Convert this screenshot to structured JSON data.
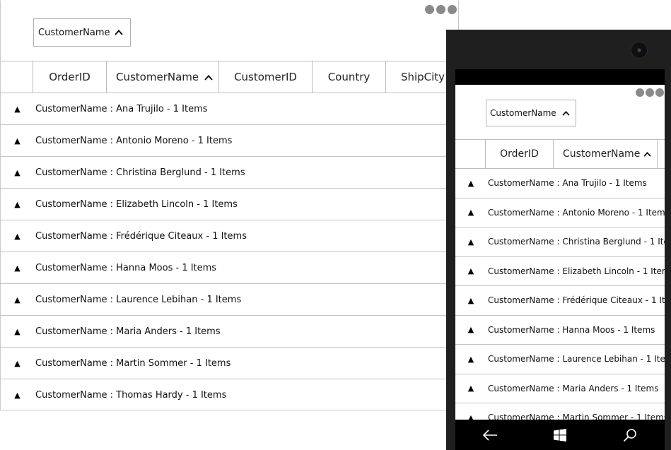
{
  "group_drop_area": {
    "chip_label": "CustomerName"
  },
  "columns": [
    "OrderID",
    "CustomerName",
    "CustomerID",
    "Country",
    "ShipCity"
  ],
  "groups": [
    {
      "caption": "CustomerName : Ana Trujilo - 1 Items"
    },
    {
      "caption": "CustomerName : Antonio Moreno - 1 Items"
    },
    {
      "caption": "CustomerName : Christina Berglund - 1 Items"
    },
    {
      "caption": "CustomerName : Elizabeth Lincoln - 1 Items"
    },
    {
      "caption": "CustomerName : Frédérique Citeaux - 1 Items"
    },
    {
      "caption": "CustomerName : Hanna Moos - 1 Items"
    },
    {
      "caption": "CustomerName : Laurence Lebihan - 1 Items"
    },
    {
      "caption": "CustomerName : Maria Anders - 1 Items"
    },
    {
      "caption": "CustomerName : Martin Sommer - 1 Items"
    },
    {
      "caption": "CustomerName : Thomas Hardy - 1 Items"
    }
  ],
  "expander_glyph": "▲",
  "icons": {
    "more": "more-dots-icon",
    "sort": "chevron-up-icon",
    "back": "back-arrow-icon",
    "home": "windows-logo-icon",
    "search": "search-icon"
  },
  "colors": {
    "grid_line": "#c4c4c4",
    "phone_bezel": "#1f1f1f",
    "more_dots": "#8a8a8a"
  }
}
